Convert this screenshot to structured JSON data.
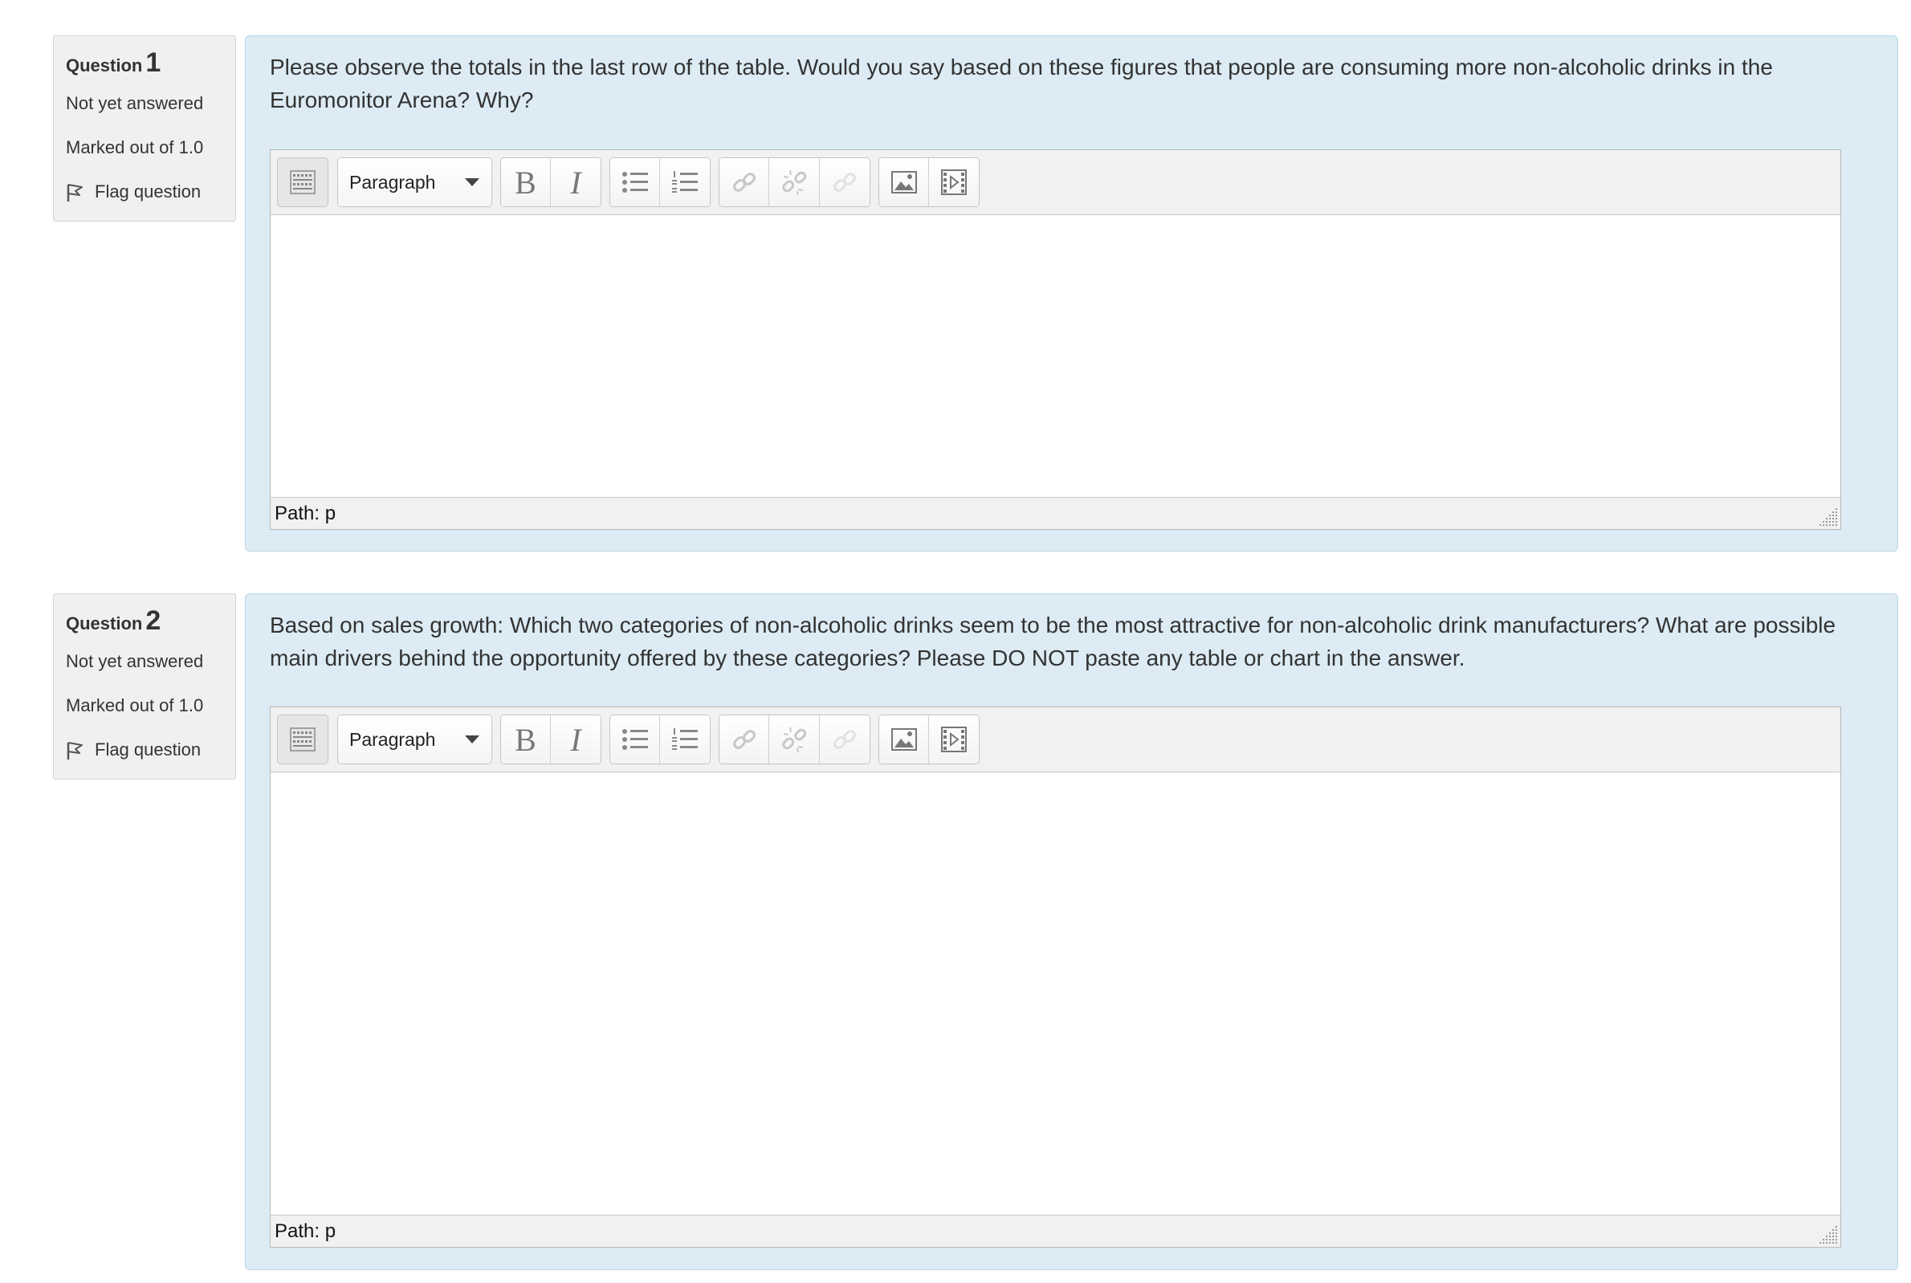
{
  "questions": [
    {
      "label": "Question",
      "number": "1",
      "status": "Not yet answered",
      "marks": "Marked out of 1.0",
      "flag_label": "Flag question",
      "text": "Please observe the totals in the last row of the table. Would you say based on these figures that people are consuming more non-alcoholic drinks in the Euromonitor Arena? Why?",
      "editor": {
        "format_select": "Paragraph",
        "bold": "B",
        "italic": "I",
        "path_label": "Path: p"
      }
    },
    {
      "label": "Question",
      "number": "2",
      "status": "Not yet answered",
      "marks": "Marked out of 1.0",
      "flag_label": "Flag question",
      "text": "Based on sales growth: Which two categories of non-alcoholic drinks seem to be the most attractive for non-alcoholic drink manufacturers? What are possible main drivers behind the opportunity offered by these categories? Please DO NOT paste any table or chart in the answer.",
      "editor": {
        "format_select": "Paragraph",
        "bold": "B",
        "italic": "I",
        "path_label": "Path: p"
      }
    }
  ],
  "icons": {
    "toolbar_toggle": "keyboard-toggle-icon",
    "dropdown": "chevron-down-icon",
    "bullet_list": "unordered-list-icon",
    "numbered_list": "ordered-list-icon",
    "link": "link-icon",
    "unlink": "unlink-icon",
    "anchor": "anchor-icon",
    "image": "image-icon",
    "media": "media-icon",
    "flag": "flag-icon",
    "resize": "resize-grip-icon"
  },
  "colors": {
    "content_bg": "#dcebf4",
    "info_bg": "#f0f0f0"
  }
}
